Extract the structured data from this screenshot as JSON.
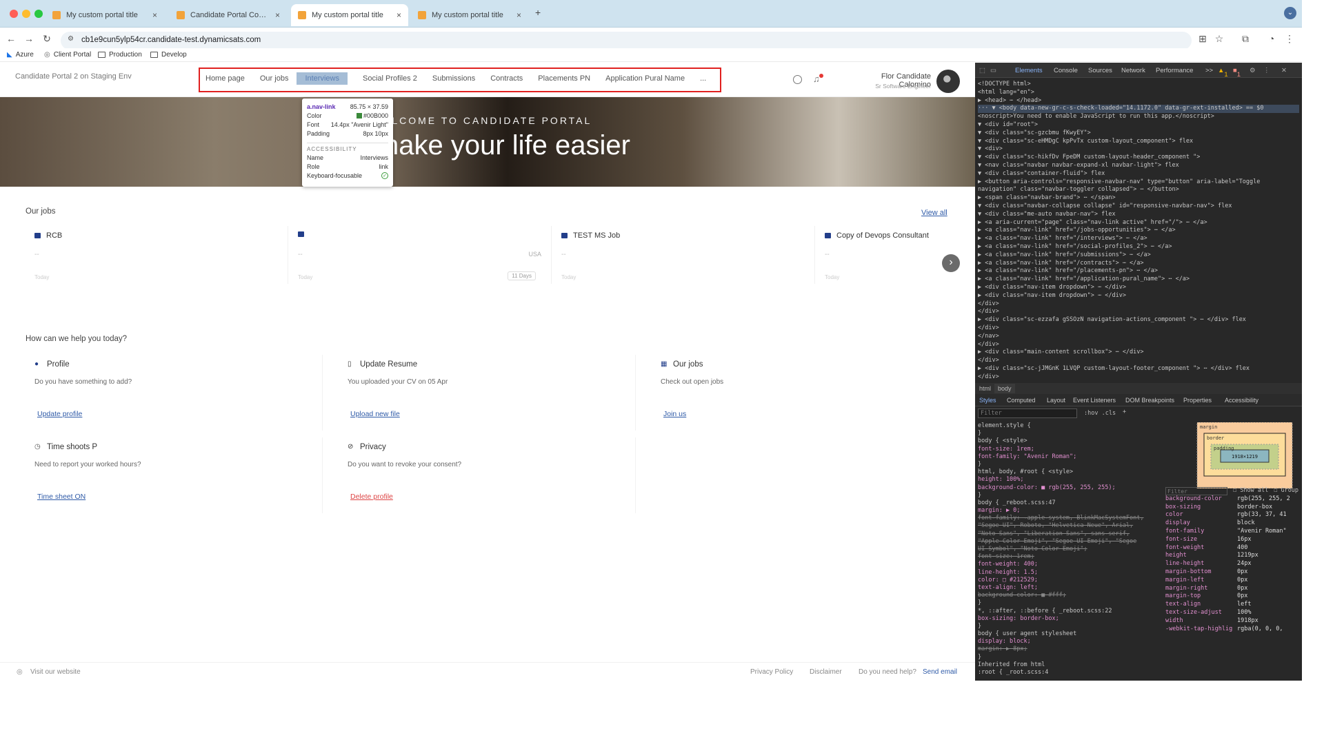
{
  "browser": {
    "tabs": [
      {
        "title": "My custom portal title",
        "active": false
      },
      {
        "title": "Candidate Portal Config HTM",
        "active": false
      },
      {
        "title": "My custom portal title",
        "active": true
      },
      {
        "title": "My custom portal title",
        "active": false
      }
    ],
    "new_tab": "+",
    "url": "cb1e9cun5ylp54cr.candidate-test.dynamicsats.com",
    "bookmarks": [
      "Azure",
      "Client Portal",
      "Production",
      "Develop"
    ]
  },
  "portal": {
    "brand": "Candidate Portal 2 on Staging Env",
    "nav": [
      "Home page",
      "Our jobs",
      "Interviews",
      "Social Profiles 2",
      "Submissions",
      "Contracts",
      "Placements PN",
      "Application Pural Name",
      "..."
    ],
    "user": {
      "name": "Flor Candidate Calomino",
      "role": "Sr Software Engineer"
    },
    "tooltip": {
      "selector": "a.nav-link",
      "size": "85.75 × 37.59",
      "rows": [
        [
          "Color",
          "#00B000"
        ],
        [
          "Font",
          "14.4px \"Avenir Light\""
        ],
        [
          "Padding",
          "8px 10px"
        ]
      ],
      "accessibility_label": "ACCESSIBILITY",
      "acc_rows": [
        [
          "Name",
          "Interviews"
        ],
        [
          "Role",
          "link"
        ],
        [
          "Keyboard-focusable",
          ""
        ]
      ]
    },
    "hero": {
      "welcome": "ELCOME TO CANDIDATE PORTAL",
      "title": "nake your life easier"
    },
    "jobs_section": {
      "title": "Our jobs",
      "view_all": "View all"
    },
    "jobs": [
      {
        "title": "RCB",
        "desc": "--",
        "location": "",
        "date": "Today",
        "days": ""
      },
      {
        "title": "",
        "desc": "--",
        "location": "USA",
        "date": "Today",
        "days": "11 Days"
      },
      {
        "title": "TEST MS Job",
        "desc": "--",
        "location": "",
        "date": "Today",
        "days": ""
      },
      {
        "title": "Copy of Devops Consultant",
        "desc": "--",
        "location": "",
        "date": "Today",
        "days": ""
      }
    ],
    "help_title": "How can we help you today?",
    "cards": [
      {
        "title": "Profile",
        "desc": "Do you have something to add?",
        "link": "Update profile"
      },
      {
        "title": "Update Resume",
        "desc": "You uploaded your CV on 05 Apr",
        "link": "Upload new file"
      },
      {
        "title": "Our jobs",
        "desc": "Check out open jobs",
        "link": "Join us"
      },
      {
        "title": "Time shoots P",
        "desc": "Need to report your worked hours?",
        "link": "Time sheet ON"
      },
      {
        "title": "Privacy",
        "desc": "Do you want to revoke your consent?",
        "link": "Delete profile"
      }
    ],
    "footer": {
      "visit": "Visit our website",
      "privacy": "Privacy Policy",
      "disclaimer": "Disclaimer",
      "help": "Do you need help?",
      "send": "Send email"
    }
  },
  "devtools": {
    "tabs": [
      "Elements",
      "Console",
      "Sources",
      "Network",
      "Performance",
      ">>"
    ],
    "warnings": "1",
    "errors": "1",
    "dom_lines": [
      "<!DOCTYPE html>",
      "<html lang=\"en\">",
      "▶ <head> ⋯ </head>",
      "··· ▼ <body data-new-gr-c-s-check-loaded=\"14.1172.0\" data-gr-ext-installed> == $0",
      "      <noscript>You need to enable JavaScript to run this app.</noscript>",
      "    ▼ <div id=\"root\">",
      "      ▼ <div class=\"sc-gzcbmu fKwyEY\">",
      "        ▼ <div class=\"sc-eHMDgC kpPvTx custom-layout_component\"> flex",
      "          ▼ <div>",
      "            ▼ <div class=\"sc-hikfDv FpeDM custom-layout-header_component \">",
      "              ▼ <nav class=\"navbar navbar-expand-xl navbar-light\"> flex",
      "                ▼ <div class=\"container-fluid\"> flex",
      "                  ▶ <button aria-controls=\"responsive-navbar-nav\" type=\"button\" aria-label=\"Toggle",
      "                    navigation\" class=\"navbar-toggler collapsed\"> ⋯ </button>",
      "                  ▶ <span class=\"navbar-brand\"> ⋯ </span>",
      "                  ▼ <div class=\"navbar-collapse collapse\" id=\"responsive-navbar-nav\"> flex",
      "                    ▼ <div class=\"me-auto navbar-nav\"> flex",
      "                      ▶ <a aria-current=\"page\" class=\"nav-link active\" href=\"/\"> ⋯ </a>",
      "                      ▶ <a class=\"nav-link\" href=\"/jobs-opportunities\"> ⋯ </a>",
      "                      ▶ <a class=\"nav-link\" href=\"/interviews\"> ⋯ </a>",
      "                      ▶ <a class=\"nav-link\" href=\"/social-profiles_2\"> ⋯ </a>",
      "                      ▶ <a class=\"nav-link\" href=\"/submissions\"> ⋯ </a>",
      "                      ▶ <a class=\"nav-link\" href=\"/contracts\"> ⋯ </a>",
      "                      ▶ <a class=\"nav-link\" href=\"/placements-pn\"> ⋯ </a>",
      "                      ▶ <a class=\"nav-link\" href=\"/application-pural_name\"> ⋯ </a>",
      "                      ▶ <div class=\"nav-item dropdown\"> ⋯ </div>",
      "                      ▶ <div class=\"nav-item dropdown\"> ⋯ </div>",
      "                      </div>",
      "                    </div>",
      "                  ▶ <div class=\"sc-ezzafa gSSOzN navigation-actions_component \"> ⋯ </div> flex",
      "                  </div>",
      "                </nav>",
      "              </div>",
      "            ▶ <div class=\"main-content scrollbox\"> ⋯ </div>",
      "            </div>",
      "          ▶ <div class=\"sc-jJMGnK 1LVQP custom-layout-footer_component \"> ⋯ </div> flex",
      "          </div>"
    ],
    "breadcrumb": [
      "html",
      "body"
    ],
    "style_tabs": [
      "Styles",
      "Computed",
      "Layout",
      "Event Listeners",
      "DOM Breakpoints",
      "Properties",
      "Accessibility"
    ],
    "filter_placeholder": "Filter",
    "hov": ":hov  .cls",
    "style_lines": [
      "element.style {",
      "}",
      "body {                                  <style>",
      "   font-size: 1rem;",
      "   font-family: \"Avenir Roman\";",
      "}",
      "html, body, #root {                     <style>",
      "   height: 100%;",
      "   background-color: ■ rgb(255, 255, 255);",
      "}",
      "body {                          _reboot.scss:47",
      "   margin: ▶ 0;",
      "   font-family: -apple-system, BlinkMacSystemFont,",
      "      \"Segoe UI\", Roboto, \"Helvetica Neue\", Arial,",
      "      \"Noto Sans\", \"Liberation Sans\", sans-serif,",
      "      \"Apple Color Emoji\", \"Segoe UI Emoji\", \"Segoe",
      "      UI Symbol\", \"Noto Color Emoji\";",
      "   font-size: 1rem;",
      "   font-weight: 400;",
      "   line-height: 1.5;",
      "   color: □ #212529;",
      "   text-align: left;",
      "   background-color: ■ #fff;",
      "}",
      "*, ::after, ::before {          _reboot.scss:22",
      "   box-sizing: border-box;",
      "}",
      "body {                      user agent stylesheet",
      "   display: block;",
      "   margin: ▶ 8px;",
      "}",
      "Inherited from html",
      ":root {                          _root.scss:4"
    ],
    "box_model": {
      "margin": "margin",
      "border": "border",
      "padding": "padding",
      "content": "1918×1219"
    },
    "computed_filter": "Filter",
    "show_all": "Show all",
    "group": "Group",
    "computed": [
      [
        "background-color",
        "rgb(255, 255, 2"
      ],
      [
        "box-sizing",
        "border-box"
      ],
      [
        "color",
        "rgb(33, 37, 41"
      ],
      [
        "display",
        "block"
      ],
      [
        "font-family",
        "\"Avenir Roman\""
      ],
      [
        "font-size",
        "16px"
      ],
      [
        "font-weight",
        "400"
      ],
      [
        "height",
        "1219px"
      ],
      [
        "line-height",
        "24px"
      ],
      [
        "margin-bottom",
        "0px"
      ],
      [
        "margin-left",
        "0px"
      ],
      [
        "margin-right",
        "0px"
      ],
      [
        "margin-top",
        "0px"
      ],
      [
        "text-align",
        "left"
      ],
      [
        "text-size-adjust",
        "100%"
      ],
      [
        "width",
        "1918px"
      ],
      [
        "-webkit-tap-highlig",
        "rgba(0, 0, 0,"
      ]
    ]
  }
}
